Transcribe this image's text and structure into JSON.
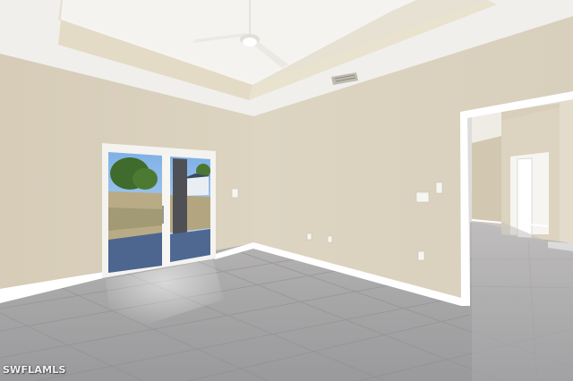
{
  "photo": {
    "scene": "empty-room-interior",
    "watermark_text": "SWFLAMLS"
  }
}
